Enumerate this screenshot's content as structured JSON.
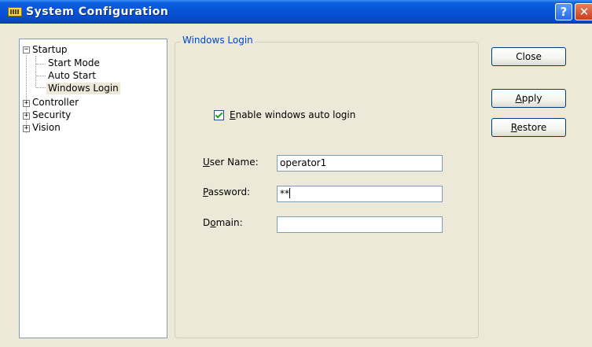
{
  "window": {
    "title": "System Configuration",
    "help_glyph": "?",
    "close_glyph": "✕"
  },
  "tree": {
    "items": [
      {
        "label": "Startup",
        "expanded": true
      },
      {
        "label": "Start Mode"
      },
      {
        "label": "Auto Start"
      },
      {
        "label": "Windows Login",
        "selected": true
      },
      {
        "label": "Controller",
        "expanded": false
      },
      {
        "label": "Security",
        "expanded": false
      },
      {
        "label": "Vision",
        "expanded": false
      }
    ],
    "minus_glyph": "−",
    "plus_glyph": "+"
  },
  "group": {
    "label": "Windows Login",
    "checkbox": {
      "checked": true,
      "first_letter": "E",
      "rest": "nable windows auto login"
    },
    "fields": {
      "username": {
        "label_first": "U",
        "label_rest": "ser Name:",
        "value": "operator1"
      },
      "password": {
        "label_first": "P",
        "label_rest": "assword:",
        "value": "**"
      },
      "domain": {
        "label_first": "D",
        "label_mid": "o",
        "label_rest": "main:",
        "value": ""
      }
    }
  },
  "buttons": {
    "close": {
      "label": "Close"
    },
    "apply": {
      "first": "A",
      "rest": "pply"
    },
    "restore": {
      "first": "R",
      "rest": "estore"
    }
  },
  "colors": {
    "titlebar": "#0752d6",
    "group_label": "#0046d5",
    "dialog_bg": "#ece9d8",
    "check_mark": "#21a121"
  },
  "icons": {
    "app": "app-window-icon",
    "help": "help-icon",
    "close": "close-icon"
  }
}
